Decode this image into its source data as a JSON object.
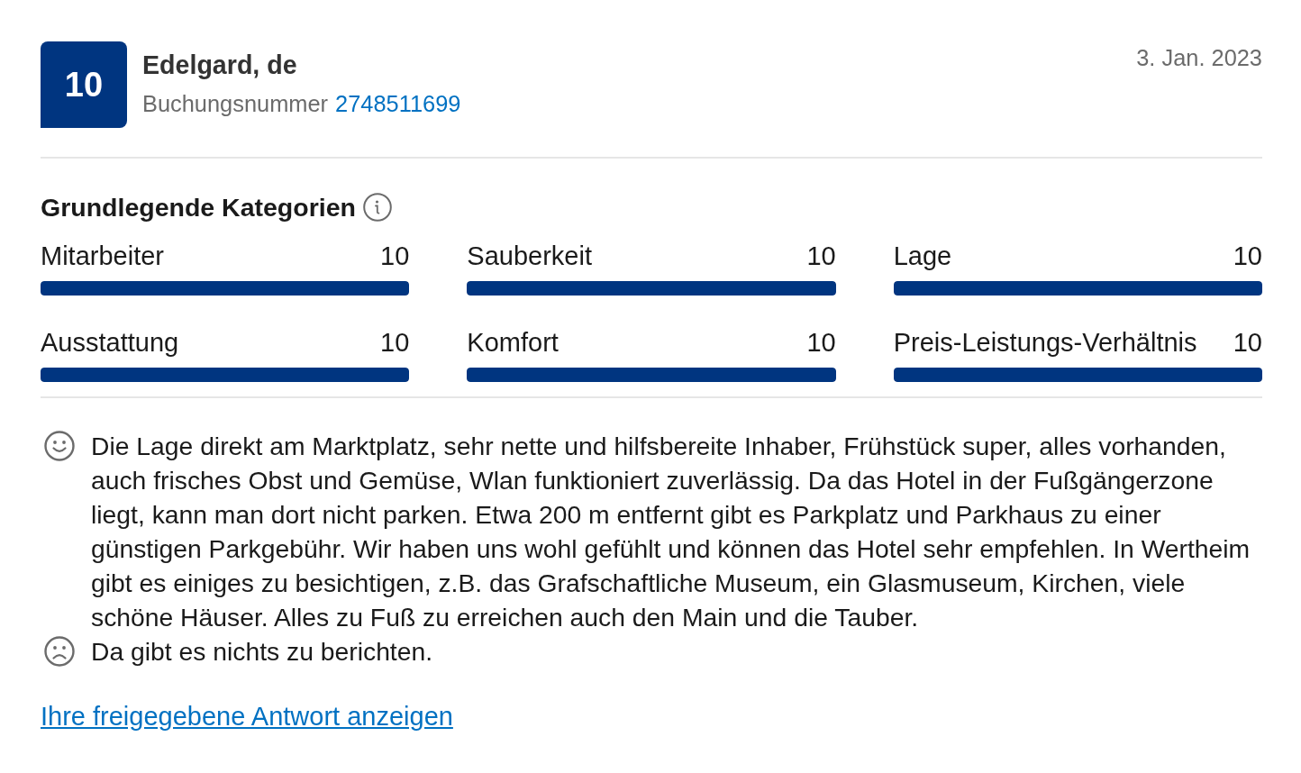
{
  "review": {
    "score": "10",
    "reviewer": "Edelgard, de",
    "booking_label": "Buchungsnummer",
    "booking_number": "2748511699",
    "date": "3. Jan. 2023"
  },
  "categories": {
    "title": "Grundlegende Kategorien",
    "items": [
      {
        "label": "Mitarbeiter",
        "score": "10",
        "level": 1
      },
      {
        "label": "Sauberkeit",
        "score": "10",
        "level": 1
      },
      {
        "label": "Lage",
        "score": "10",
        "level": 1
      },
      {
        "label": "Ausstattung",
        "score": "10",
        "level": 1
      },
      {
        "label": "Komfort",
        "score": "10",
        "level": 1
      },
      {
        "label": "Preis-Leistungs-Verhältnis",
        "score": "10",
        "level": 1
      }
    ]
  },
  "comments": [
    {
      "kind": "positive",
      "text": "Die Lage direkt am Marktplatz, sehr nette und hilfsbereite Inhaber, Frühstück super, alles vorhanden, auch frisches Obst und Gemüse, Wlan funktioniert zuverlässig. Da das Hotel in der Fußgängerzone liegt, kann man dort nicht parken. Etwa 200 m entfernt gibt es Parkplatz und Parkhaus zu einer günstigen Parkgebühr. Wir haben uns wohl gefühlt und können das Hotel sehr empfehlen. In Wertheim gibt es einiges zu besichtigen, z.B. das Grafschaftliche Museum, ein Glasmuseum, Kirchen, viele schöne Häuser. Alles zu Fuß zu erreichen auch den Main und die Tauber."
    },
    {
      "kind": "negative",
      "text": "Da gibt es nichts zu berichten."
    }
  ],
  "response_link": "Ihre freigegebene Antwort anzeigen"
}
